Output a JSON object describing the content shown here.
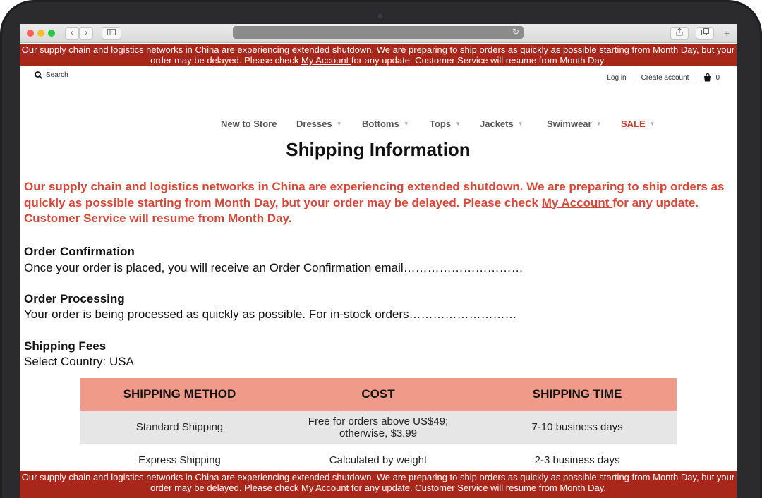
{
  "banner": {
    "part1": "Our supply chain and logistics networks in China are experiencing extended shutdown. We are preparing to ship orders as quickly as possible starting from Month Day, but your order may be delayed. Please check ",
    "link": "My Account ",
    "part2": "for any update. Customer Service will resume from Month Day."
  },
  "header": {
    "search_label": "Search",
    "login_label": "Log in",
    "create_account_label": "Create account",
    "cart_count": "0"
  },
  "nav": {
    "items": [
      {
        "label": "New to Store"
      },
      {
        "label": "Dresses"
      },
      {
        "label": "Bottoms"
      },
      {
        "label": "Tops"
      },
      {
        "label": "Jackets"
      },
      {
        "label": "Swimwear"
      },
      {
        "label": "SALE"
      }
    ],
    "sale_color": "#c9362a"
  },
  "page": {
    "title": "Shipping Information",
    "notice_part1": "Our supply chain and logistics networks in China are experiencing extended shutdown. We are preparing to ship orders as quickly as possible starting from Month Day, but your order may be delayed. Please check ",
    "notice_link": "My Account ",
    "notice_part2": "for any update. Customer Service will resume from Month Day.",
    "notice_color": "#d0493a"
  },
  "sections": {
    "order_confirmation": {
      "heading": "Order Confirmation",
      "text": "Once your order is placed, you will receive an Order Confirmation email…………………………"
    },
    "order_processing": {
      "heading": "Order Processing",
      "text": "Your order is being processed as quickly as possible. For in-stock orders………………………"
    },
    "shipping_fees": {
      "heading": "Shipping Fees",
      "text": "Select Country: USA"
    }
  },
  "shipping_table": {
    "headers": [
      "SHIPPING METHOD",
      "COST",
      "SHIPPING TIME"
    ],
    "header_color": "#f09a8a",
    "rows": [
      [
        "Standard Shipping",
        "Free for orders above US$49; otherwise, $3.99",
        "7-10 business days"
      ],
      [
        "Express Shipping",
        "Calculated by weight",
        "2-3 business days"
      ]
    ]
  },
  "colors": {
    "banner_bg": "#a8271b"
  }
}
